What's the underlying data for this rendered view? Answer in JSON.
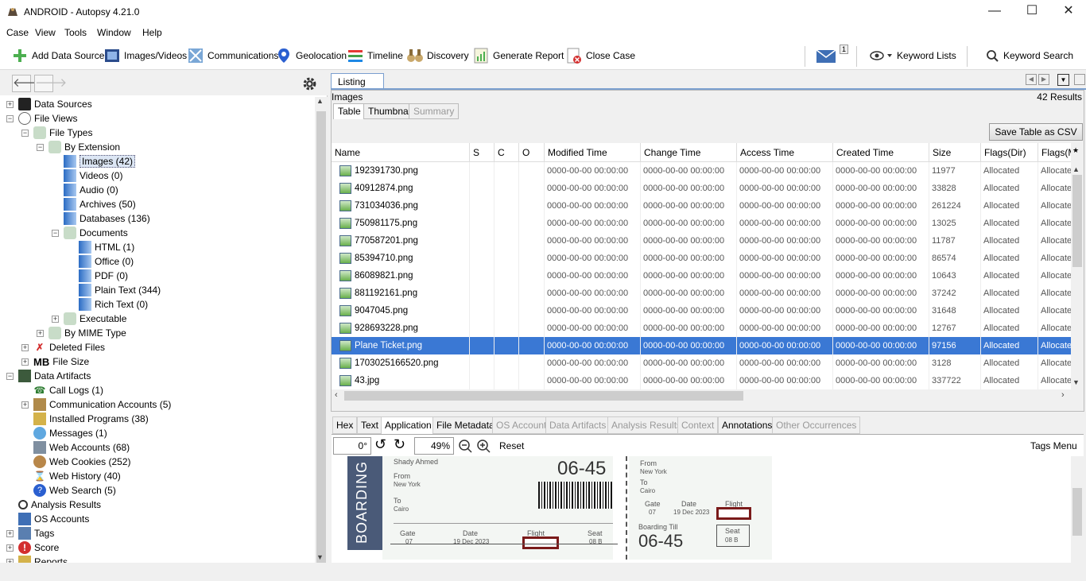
{
  "window": {
    "title": "ANDROID - Autopsy 4.21.0",
    "minimize": "—",
    "maximize": "☐",
    "close": "✕"
  },
  "menu": [
    "Case",
    "View",
    "Tools",
    "Window",
    "Help"
  ],
  "toolbar": {
    "add_data_source": "Add Data Source",
    "images_videos": "Images/Videos",
    "communications": "Communications",
    "geolocation": "Geolocation",
    "timeline": "Timeline",
    "discovery": "Discovery",
    "generate_report": "Generate Report",
    "close_case": "Close Case",
    "notification_count": "1",
    "keyword_lists": "Keyword Lists",
    "keyword_search": "Keyword Search"
  },
  "tree": {
    "data_sources": "Data Sources",
    "file_views": "File Views",
    "file_types": "File Types",
    "by_extension": "By Extension",
    "images": "Images (42)",
    "videos": "Videos (0)",
    "audio": "Audio (0)",
    "archives": "Archives (50)",
    "databases": "Databases (136)",
    "documents": "Documents",
    "html": "HTML (1)",
    "office": "Office (0)",
    "pdf": "PDF (0)",
    "plain_text": "Plain Text (344)",
    "rich_text": "Rich Text (0)",
    "executable": "Executable",
    "by_mime": "By MIME Type",
    "deleted_files": "Deleted Files",
    "file_size": "File Size",
    "file_size_badge": "MB",
    "data_artifacts": "Data Artifacts",
    "call_logs": "Call Logs (1)",
    "comm_accounts": "Communication Accounts (5)",
    "installed_programs": "Installed Programs (38)",
    "messages": "Messages (1)",
    "web_accounts": "Web Accounts (68)",
    "web_cookies": "Web Cookies (252)",
    "web_history": "Web History (40)",
    "web_search": "Web Search (5)",
    "analysis_results": "Analysis Results",
    "os_accounts": "OS Accounts",
    "tags": "Tags",
    "score": "Score",
    "reports": "Reports"
  },
  "listing": {
    "tab": "Listing",
    "heading": "Images",
    "results": "42  Results",
    "tabs": {
      "table": "Table",
      "thumbnail": "Thumbnail",
      "summary": "Summary"
    },
    "save_csv": "Save Table as CSV",
    "columns": [
      "Name",
      "S",
      "C",
      "O",
      "Modified Time",
      "Change Time",
      "Access Time",
      "Created Time",
      "Size",
      "Flags(Dir)",
      "Flags(M"
    ],
    "rows": [
      {
        "name": "192391730.png",
        "size": "11977",
        "flags": "Allocated"
      },
      {
        "name": "40912874.png",
        "size": "33828",
        "flags": "Allocated"
      },
      {
        "name": "731034036.png",
        "size": "261224",
        "flags": "Allocated"
      },
      {
        "name": "750981175.png",
        "size": "13025",
        "flags": "Allocated"
      },
      {
        "name": "770587201.png",
        "size": "11787",
        "flags": "Allocated"
      },
      {
        "name": "85394710.png",
        "size": "86574",
        "flags": "Allocated"
      },
      {
        "name": "86089821.png",
        "size": "10643",
        "flags": "Allocated"
      },
      {
        "name": "881192161.png",
        "size": "37242",
        "flags": "Allocated"
      },
      {
        "name": "9047045.png",
        "size": "31648",
        "flags": "Allocated"
      },
      {
        "name": "928693228.png",
        "size": "12767",
        "flags": "Allocated"
      },
      {
        "name": "Plane Ticket.png",
        "size": "97156",
        "flags": "Allocated"
      },
      {
        "name": "1703025166520.png",
        "size": "3128",
        "flags": "Allocated"
      },
      {
        "name": "43.jpg",
        "size": "337722",
        "flags": "Allocated"
      }
    ],
    "time_value": "0000-00-00 00:00:00",
    "flags_m_value": "Allocate"
  },
  "viewer": {
    "tabs": [
      "Hex",
      "Text",
      "Application",
      "File Metadata",
      "OS Account",
      "Data Artifacts",
      "Analysis Results",
      "Context",
      "Annotations",
      "Other Occurrences"
    ],
    "rotation": "0°",
    "zoom": "49%",
    "reset": "Reset",
    "tags_menu": "Tags Menu"
  },
  "ticket": {
    "boarding": "BOARDING P",
    "passenger": "Shady Ahmed",
    "from_label": "From",
    "from_value": "New York",
    "to_label": "To",
    "to_value": "Cairo",
    "gate_label": "Gate",
    "gate_value": "07",
    "date_label": "Date",
    "date_value": "19 Dec 2023",
    "flight_label": "Flight",
    "seat_label": "Seat",
    "seat_value": "08 B",
    "time": "06-45",
    "boarding_till": "Boarding Till"
  }
}
